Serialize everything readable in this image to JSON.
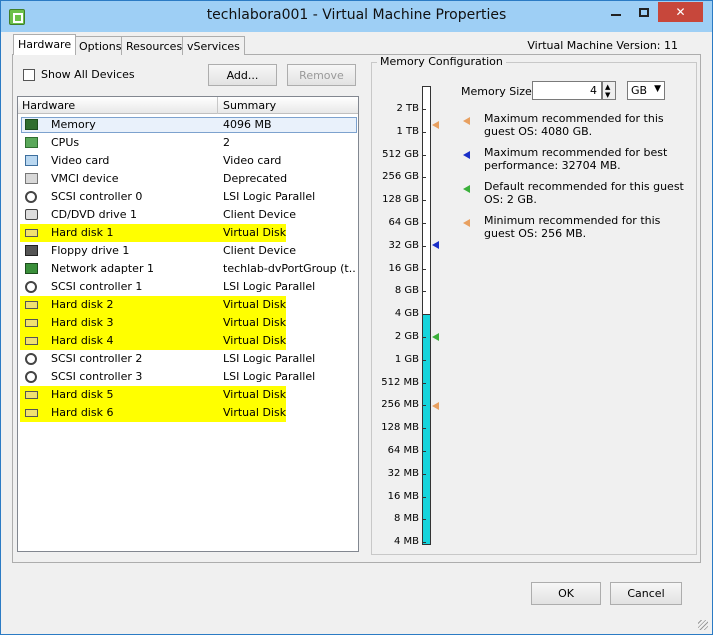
{
  "window": {
    "title": "techlabora001 - Virtual Machine Properties"
  },
  "tabs": [
    "Hardware",
    "Options",
    "Resources",
    "vServices"
  ],
  "vm_version": "Virtual Machine Version: 11",
  "toolbar": {
    "show_all_devices": "Show All Devices",
    "add_label": "Add...",
    "remove_label": "Remove"
  },
  "hardware_table": {
    "columns": [
      "Hardware",
      "Summary"
    ],
    "rows": [
      {
        "name": "Memory",
        "summary": "4096 MB",
        "icon": "memory-icon",
        "highlighted": false,
        "selected": true
      },
      {
        "name": "CPUs",
        "summary": "2",
        "icon": "cpu-icon",
        "highlighted": false
      },
      {
        "name": "Video card",
        "summary": "Video card",
        "icon": "video-card-icon",
        "highlighted": false
      },
      {
        "name": "VMCI device",
        "summary": "Deprecated",
        "icon": "vmci-icon",
        "highlighted": false
      },
      {
        "name": "SCSI controller 0",
        "summary": "LSI Logic Parallel",
        "icon": "scsi-controller-icon",
        "highlighted": false
      },
      {
        "name": "CD/DVD drive 1",
        "summary": "Client Device",
        "icon": "cd-dvd-icon",
        "highlighted": false
      },
      {
        "name": "Hard disk 1",
        "summary": "Virtual Disk",
        "icon": "hard-disk-icon",
        "highlighted": true
      },
      {
        "name": "Floppy drive 1",
        "summary": "Client Device",
        "icon": "floppy-icon",
        "highlighted": false
      },
      {
        "name": "Network adapter 1",
        "summary": "techlab-dvPortGroup (t...",
        "icon": "network-adapter-icon",
        "highlighted": false
      },
      {
        "name": "SCSI controller 1",
        "summary": "LSI Logic Parallel",
        "icon": "scsi-controller-icon",
        "highlighted": false
      },
      {
        "name": "Hard disk 2",
        "summary": "Virtual Disk",
        "icon": "hard-disk-icon",
        "highlighted": true
      },
      {
        "name": "Hard disk 3",
        "summary": "Virtual Disk",
        "icon": "hard-disk-icon",
        "highlighted": true
      },
      {
        "name": "Hard disk 4",
        "summary": "Virtual Disk",
        "icon": "hard-disk-icon",
        "highlighted": true
      },
      {
        "name": "SCSI controller 2",
        "summary": "LSI Logic Parallel",
        "icon": "scsi-controller-icon",
        "highlighted": false
      },
      {
        "name": "SCSI controller 3",
        "summary": "LSI Logic Parallel",
        "icon": "scsi-controller-icon",
        "highlighted": false
      },
      {
        "name": "Hard disk 5",
        "summary": "Virtual Disk",
        "icon": "hard-disk-icon",
        "highlighted": true
      },
      {
        "name": "Hard disk 6",
        "summary": "Virtual Disk",
        "icon": "hard-disk-icon",
        "highlighted": true
      }
    ]
  },
  "memory_config": {
    "title": "Memory Configuration",
    "scale_labels": [
      "2 TB",
      "1 TB",
      "512 GB",
      "256 GB",
      "128 GB",
      "64 GB",
      "32 GB",
      "16 GB",
      "8 GB",
      "4 GB",
      "2 GB",
      "1 GB",
      "512 MB",
      "256 MB",
      "128 MB",
      "64 MB",
      "32 MB",
      "16 MB",
      "8 MB",
      "4 MB"
    ],
    "memory_size_label": "Memory Size:",
    "memory_size_value": "4",
    "unit": "GB",
    "legend": [
      {
        "text": "Maximum recommended for this guest OS: 4080 GB.",
        "marker": "max-recommended-marker",
        "color": "#e8a060"
      },
      {
        "text": "Maximum recommended for best performance: 32704 MB.",
        "marker": "best-performance-marker",
        "color": "#1a2fc8"
      },
      {
        "text": "Default recommended for this guest OS: 2 GB.",
        "marker": "default-recommended-marker",
        "color": "#3ab03a"
      },
      {
        "text": "Minimum recommended for this guest OS: 256 MB.",
        "marker": "min-recommended-marker",
        "color": "#e8a060"
      }
    ]
  },
  "footer": {
    "ok_label": "OK",
    "cancel_label": "Cancel"
  },
  "colors": {
    "highlight": "#ffff00",
    "memory_fill": "#16d4dc",
    "title_bar": "#9ecff5"
  }
}
